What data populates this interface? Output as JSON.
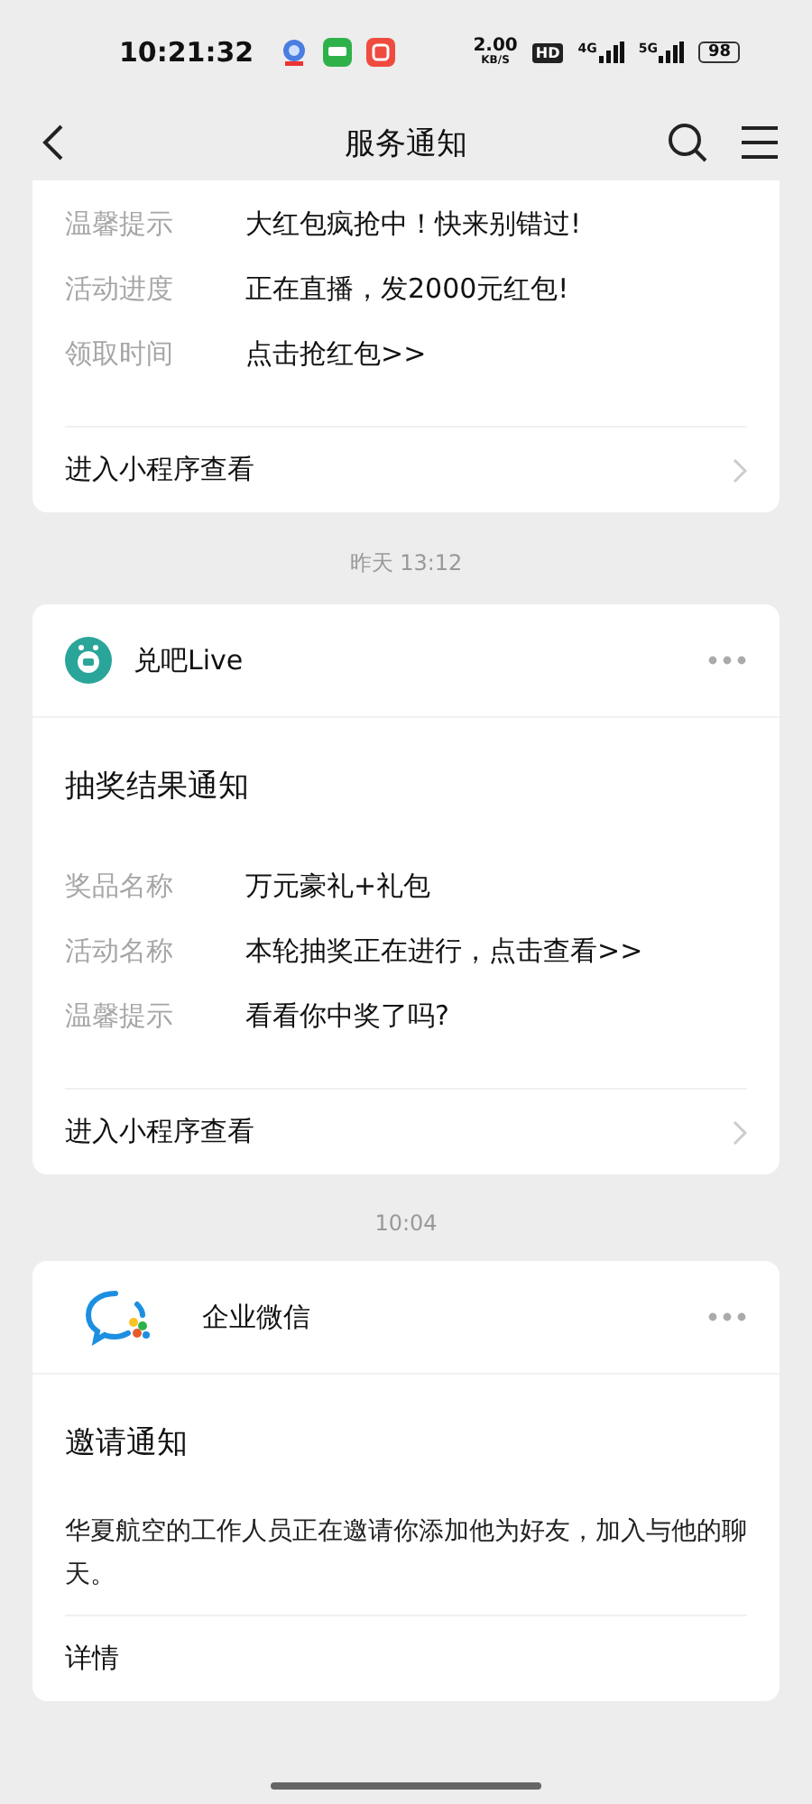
{
  "status_bar": {
    "time": "10:21:32",
    "speed": "2.00",
    "speed_unit": "KB/S",
    "hd": "HD",
    "signal_1": "4G",
    "signal_2": "5G",
    "battery": "98"
  },
  "nav": {
    "title": "服务通知"
  },
  "feed": [
    {
      "kind": "card",
      "fields": [
        {
          "label": "温馨提示",
          "value": "大红包疯抢中！快来别错过!"
        },
        {
          "label": "活动进度",
          "value": "正在直播，发2000元红包!"
        },
        {
          "label": "领取时间",
          "value": "点击抢红包>>"
        }
      ],
      "footer": {
        "label": "进入小程序查看",
        "chevron": true
      }
    },
    {
      "kind": "timestamp",
      "text": "昨天 13:12"
    },
    {
      "kind": "card",
      "header": {
        "name": "兑吧Live",
        "kind": "round"
      },
      "title": "抽奖结果通知",
      "fields": [
        {
          "label": "奖品名称",
          "value": "万元豪礼+礼包"
        },
        {
          "label": "活动名称",
          "value": "本轮抽奖正在进行，点击查看>>"
        },
        {
          "label": "温馨提示",
          "value": "看看你中奖了吗?"
        }
      ],
      "footer": {
        "label": "进入小程序查看",
        "chevron": true
      }
    },
    {
      "kind": "timestamp",
      "text": "10:04"
    },
    {
      "kind": "card",
      "header": {
        "name": "企业微信",
        "kind": "bubbles"
      },
      "title": "邀请通知",
      "paragraph": "华夏航空的工作人员正在邀请你添加他为好友，加入与他的聊天。",
      "footer": {
        "label": "详情",
        "chevron": false
      }
    }
  ]
}
